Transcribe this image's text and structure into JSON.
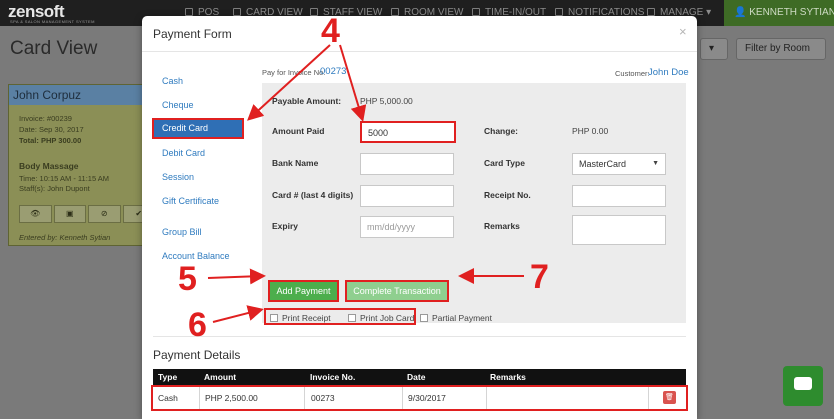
{
  "navbar": {
    "brand": "zensoft",
    "brand_tagline": "SPA & SALON MANAGEMENT SYSTEM",
    "items": [
      {
        "label": "POS"
      },
      {
        "label": "CARD VIEW"
      },
      {
        "label": "STAFF VIEW"
      },
      {
        "label": "ROOM VIEW"
      },
      {
        "label": "TIME-IN/OUT"
      },
      {
        "label": "NOTIFICATIONS"
      },
      {
        "label": "MANAGE"
      }
    ],
    "user": "KENNETH SYTIAN"
  },
  "background": {
    "page_title": "Card View",
    "filter_label": "Filter by Room",
    "card": {
      "customer": "John Corpuz",
      "invoice": "Invoice: #00239",
      "date": "Date: Sep 30, 2017",
      "total": "Total: PHP 300.00",
      "service": "Body Massage",
      "time": "Time: 10:15 AM - 11:15 AM",
      "staff": "Staff(s): John Dupont",
      "entered_by": "Entered by: Kenneth Sytian"
    }
  },
  "modal": {
    "title": "Payment Form",
    "close": "×",
    "payment_methods": [
      {
        "label": "Cash"
      },
      {
        "label": "Cheque"
      },
      {
        "label": "Credit Card"
      },
      {
        "label": "Debit Card"
      },
      {
        "label": "Session"
      },
      {
        "label": "Gift Certificate"
      },
      {
        "label": "Group Bill"
      },
      {
        "label": "Account Balance"
      }
    ],
    "invoice_label": "Pay for Invoice No.",
    "invoice_no": "00273",
    "customer_label": "Customer:",
    "customer_name": "John Doe",
    "form": {
      "payable_amount_label": "Payable Amount:",
      "payable_amount_value": "PHP 5,000.00",
      "amount_paid_label": "Amount Paid",
      "amount_paid_value": "5000",
      "change_label": "Change:",
      "change_value": "PHP 0.00",
      "bank_name_label": "Bank Name",
      "card_type_label": "Card Type",
      "card_type_value": "MasterCard",
      "card_number_label": "Card # (last 4 digits)",
      "receipt_no_label": "Receipt No.",
      "expiry_label": "Expiry",
      "expiry_placeholder": "mm/dd/yyyy",
      "remarks_label": "Remarks"
    },
    "buttons": {
      "add_payment": "Add Payment",
      "complete_transaction": "Complete Transaction"
    },
    "checkboxes": {
      "print_receipt": "Print Receipt",
      "print_job_card": "Print Job Card",
      "partial_payment": "Partial Payment"
    },
    "payment_details": {
      "title": "Payment Details",
      "columns": [
        "Type",
        "Amount",
        "Invoice No.",
        "Date",
        "Remarks"
      ],
      "rows": [
        {
          "type": "Cash",
          "amount": "PHP 2,500.00",
          "invoice": "00273",
          "date": "9/30/2017",
          "remarks": ""
        }
      ]
    }
  },
  "annotations": {
    "n4": "4",
    "n5": "5",
    "n6": "6",
    "n7": "7",
    "color": "#e02020"
  }
}
